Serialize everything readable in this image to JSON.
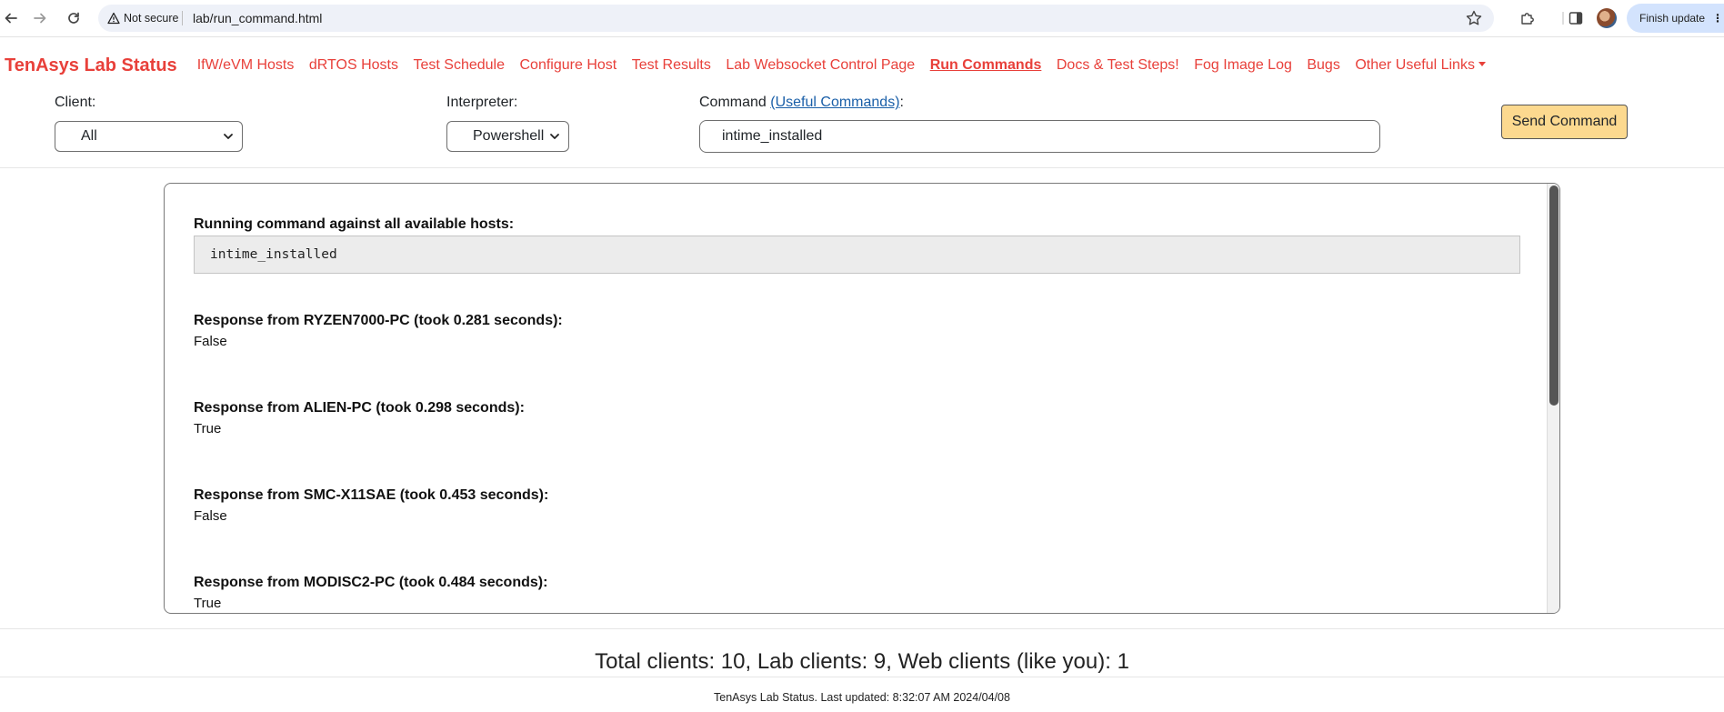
{
  "browser": {
    "security_label": "Not secure",
    "url": "lab/run_command.html",
    "finish_update_label": "Finish update"
  },
  "site": {
    "brand": "TenAsys Lab Status",
    "nav": [
      {
        "label": "IfW/eVM Hosts",
        "active": false
      },
      {
        "label": "dRTOS Hosts",
        "active": false
      },
      {
        "label": "Test Schedule",
        "active": false
      },
      {
        "label": "Configure Host",
        "active": false
      },
      {
        "label": "Test Results",
        "active": false
      },
      {
        "label": "Lab Websocket Control Page",
        "active": false
      },
      {
        "label": "Run Commands",
        "active": true
      },
      {
        "label": "Docs & Test Steps!",
        "active": false
      },
      {
        "label": "Fog Image Log",
        "active": false
      },
      {
        "label": "Bugs",
        "active": false
      },
      {
        "label": "Other Useful Links",
        "active": false,
        "dropdown": true
      }
    ]
  },
  "form": {
    "client_label": "Client:",
    "client_value": "All",
    "interpreter_label": "Interpreter:",
    "interpreter_value": "Powershell",
    "command_label": "Command",
    "useful_commands_link": "(Useful Commands)",
    "command_label_suffix": ":",
    "command_value": "intime_installed",
    "send_button": "Send Command"
  },
  "output": {
    "title": "Running command against all available hosts:",
    "command": "intime_installed",
    "responses": [
      {
        "header": "Response from RYZEN7000-PC (took 0.281 seconds):",
        "value": "False"
      },
      {
        "header": "Response from ALIEN-PC (took 0.298 seconds):",
        "value": "True"
      },
      {
        "header": "Response from SMC-X11SAE (took 0.453 seconds):",
        "value": "False"
      },
      {
        "header": "Response from MODISC2-PC (took 0.484 seconds):",
        "value": "True"
      }
    ]
  },
  "footer": {
    "totals": "Total clients: 10, Lab clients: 9, Web clients (like you): 1",
    "status": "TenAsys Lab Status. Last updated: 8:32:07 AM 2024/04/08"
  }
}
